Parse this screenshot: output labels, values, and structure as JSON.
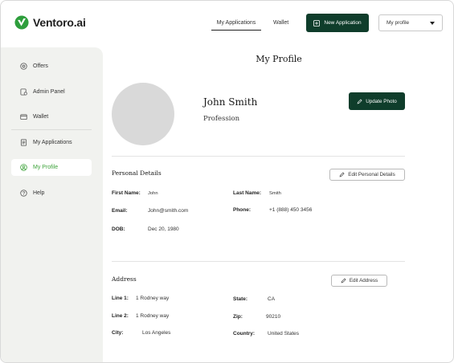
{
  "header": {
    "logo_text": "Ventoro.ai",
    "nav": [
      {
        "label": "My Applications",
        "active": true
      },
      {
        "label": "Wallet",
        "active": false
      }
    ],
    "new_application_label": "New Application",
    "profile_select_value": "My profile"
  },
  "sidebar": {
    "items": [
      {
        "label": "Offers",
        "icon": "offers-icon"
      },
      {
        "label": "Admin Panel",
        "icon": "admin-panel-icon"
      },
      {
        "label": "Wallet",
        "icon": "wallet-icon"
      },
      {
        "label": "My Applications",
        "icon": "applications-icon"
      },
      {
        "label": "My Profile",
        "icon": "profile-icon",
        "active": true
      },
      {
        "label": "Help",
        "icon": "help-icon"
      }
    ]
  },
  "profile": {
    "page_title": "My Profile",
    "name": "John Smith",
    "profession": "Profession",
    "update_photo_label": "Update Photo"
  },
  "personal": {
    "title": "Personal Details",
    "edit_label": "Edit Personal Details",
    "fields": [
      {
        "label": "First Name:",
        "value": "John"
      },
      {
        "label": "Last Name:",
        "value": "Smith"
      },
      {
        "label": "Email:",
        "value": "John@smith.com"
      },
      {
        "label": "Phone:",
        "value": "+1 (888) 450 3456"
      },
      {
        "label": "DOB:",
        "value": "Dec 20, 1980"
      }
    ]
  },
  "address": {
    "title": "Address",
    "edit_label": "Edit Address",
    "fields": [
      {
        "label": "Line 1:",
        "value": "1 Rodney way"
      },
      {
        "label": "State:",
        "value": "CA"
      },
      {
        "label": "Line 2:",
        "value": "1 Rodney way"
      },
      {
        "label": "Zip:",
        "value": "90210"
      },
      {
        "label": "City:",
        "value": "Los Angeles"
      },
      {
        "label": "Country:",
        "value": "United States"
      }
    ]
  },
  "colors": {
    "brand_dark": "#0f3d2b",
    "accent_green": "#3da33a",
    "sidebar_bg": "#f1f2ef",
    "avatar_placeholder": "#d9d9d9"
  }
}
